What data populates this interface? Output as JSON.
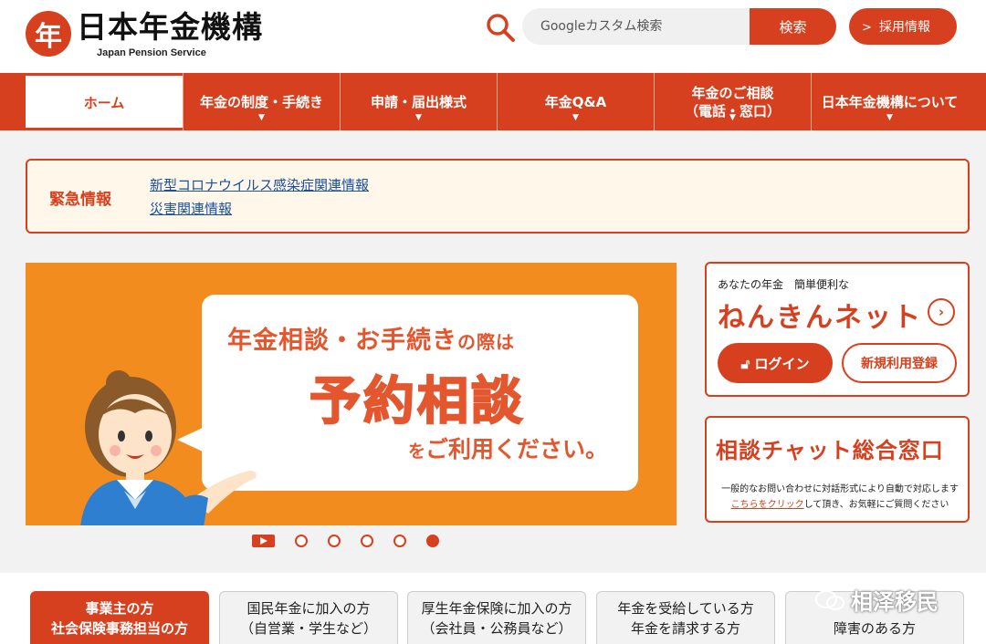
{
  "header": {
    "logo_mark": "年",
    "logo_title": "日本年金機構",
    "logo_sub": "Japan Pension Service",
    "search_placeholder": "Googleカスタム検索",
    "search_button": "検索",
    "recruit_button": "採用情報"
  },
  "nav": {
    "items": [
      {
        "label": "ホーム",
        "label2": ""
      },
      {
        "label": "年金の制度・手続き",
        "label2": ""
      },
      {
        "label": "申請・届出様式",
        "label2": ""
      },
      {
        "label": "年金Q&A",
        "label2": ""
      },
      {
        "label": "年金のご相談",
        "label2": "（電話・窓口）"
      },
      {
        "label": "日本年金機構について",
        "label2": ""
      }
    ]
  },
  "emergency": {
    "title": "緊急情報",
    "links": [
      "新型コロナウイルス感染症関連情報",
      "災害関連情報"
    ]
  },
  "banner": {
    "line1_big": "年金相談・お手続き",
    "line1_small": "の際は",
    "line2": "予約相談",
    "line3_small": "を",
    "line3_big": "ご利用ください。"
  },
  "carousel": {
    "slides": 6,
    "active_index": 5
  },
  "nenkin_net": {
    "subtitle": "あなたの年金　簡単便利な",
    "title": "ねんきんネット",
    "arrow": "›",
    "login": "ログイン",
    "register": "新規利用登録"
  },
  "chat": {
    "title": "相談チャット総合窓口",
    "desc_line1": "一般的なお問い合わせに対話形式により自動で対応します",
    "desc_link": "こちらをクリック",
    "desc_line2": "して頂き、お気軽にご質問ください"
  },
  "categories": [
    {
      "line1": "事業主の方",
      "line2": "社会保険事務担当の方"
    },
    {
      "line1": "国民年金に加入の方",
      "line2": "（自営業・学生など）"
    },
    {
      "line1": "厚生年金保険に加入の方",
      "line2": "（会社員・公務員など）"
    },
    {
      "line1": "年金を受給している方",
      "line2": "年金を請求する方"
    },
    {
      "line1": "",
      "line2": "障害のある方"
    }
  ],
  "watermark": "相泽移民",
  "colors": {
    "brand": "#d7401e",
    "banner": "#f28c1f",
    "link": "#1a4fa3"
  }
}
